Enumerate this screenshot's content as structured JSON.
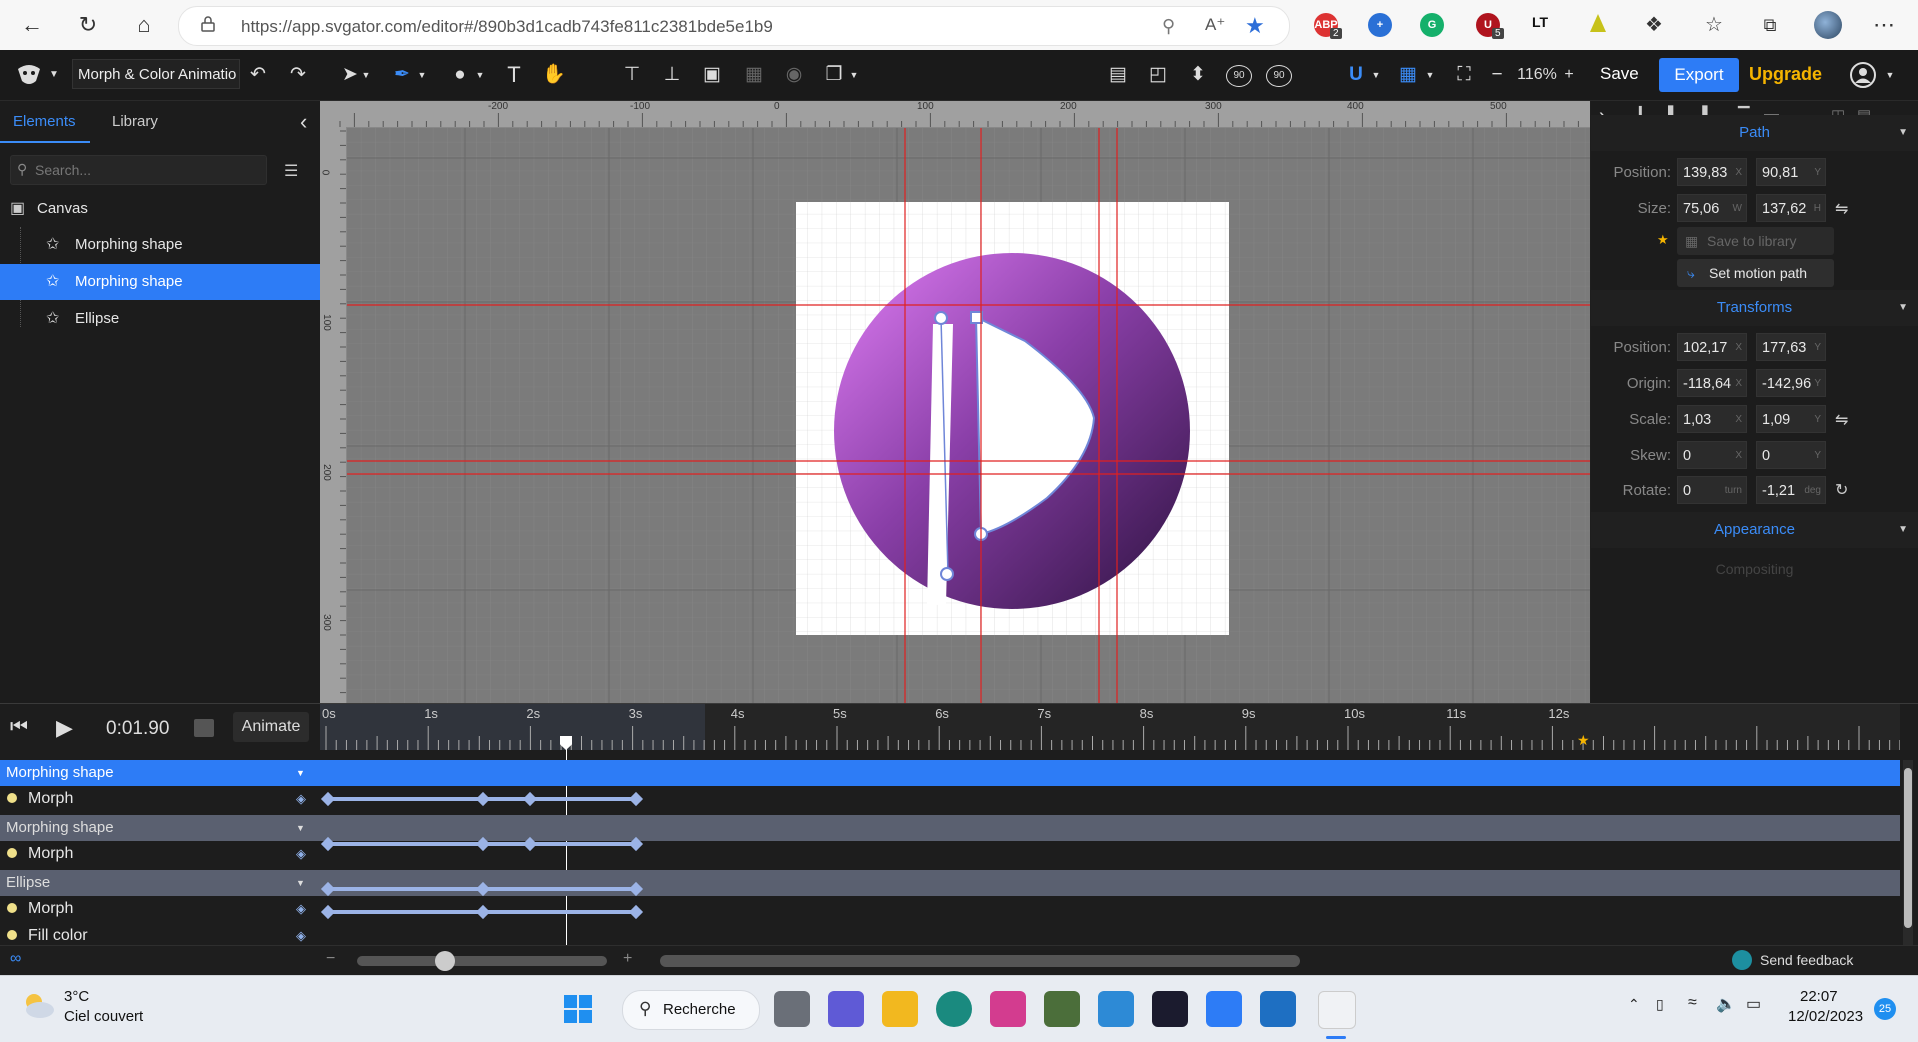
{
  "browser": {
    "url": "https://app.svgator.com/editor#/890b3d1cadb743fe811c2381bde5e1b9",
    "ext_badge_1": "2",
    "ext_badge_2": "5",
    "ext_lt": "LT"
  },
  "toolbar": {
    "doc_name": "Morph & Color Animatio",
    "zoom": "116%",
    "zoom_minus": "−",
    "zoom_plus": "+",
    "save_label": "Save",
    "export_label": "Export",
    "upgrade_label": "Upgrade",
    "rot_90a": "90",
    "rot_90b": "90"
  },
  "left_panel": {
    "tab_elements": "Elements",
    "tab_library": "Library",
    "search_placeholder": "Search...",
    "tree": [
      {
        "label": "Canvas"
      },
      {
        "label": "Morphing shape"
      },
      {
        "label": "Morphing shape"
      },
      {
        "label": "Ellipse"
      }
    ]
  },
  "ruler": {
    "top": [
      "-200",
      "-100",
      "0",
      "100",
      "200",
      "300",
      "400",
      "500"
    ],
    "left": [
      "0",
      "100",
      "200",
      "300"
    ]
  },
  "right_panel": {
    "path_title": "Path",
    "position_label": "Position:",
    "size_label": "Size:",
    "path_pos_x": "139,83",
    "path_pos_y": "90,81",
    "size_w": "75,06",
    "size_h": "137,62",
    "save_to_library": "Save to library",
    "set_motion_path": "Set motion path",
    "transforms_title": "Transforms",
    "origin_label": "Origin:",
    "scale_label": "Scale:",
    "skew_label": "Skew:",
    "rotate_label": "Rotate:",
    "t_pos_x": "102,17",
    "t_pos_y": "177,63",
    "origin_x": "-118,64",
    "origin_y": "-142,96",
    "scale_x": "1,03",
    "scale_y": "1,09",
    "skew_x": "0",
    "skew_y": "0",
    "rotate_turn": "0",
    "rotate_deg": "-1,21",
    "unit_x": "X",
    "unit_y": "Y",
    "unit_w": "W",
    "unit_h": "H",
    "unit_turn": "turn",
    "unit_deg": "deg",
    "appearance_title": "Appearance",
    "compositing_partial": "Compositing"
  },
  "timeline": {
    "time": "0:01.90",
    "animate_label": "Animate",
    "ticks": [
      "0s",
      "1s",
      "2s",
      "3s",
      "4s",
      "5s",
      "6s",
      "7s",
      "8s",
      "9s",
      "10s",
      "11s",
      "12s"
    ],
    "group1": "Morphing shape",
    "group2": "Morphing shape",
    "group3": "Ellipse",
    "morph": "Morph",
    "fill_color": "Fill color",
    "send_feedback": "Send feedback",
    "zoom_minus": "−",
    "zoom_plus": "+"
  },
  "taskbar": {
    "temperature": "3°C",
    "weather": "Ciel couvert",
    "search_label": "Recherche",
    "time": "22:07",
    "date": "12/02/2023",
    "notif_count": "25"
  },
  "colors": {
    "accent": "#2d7cf6",
    "ellipse_gradient_start": "#d66cec",
    "ellipse_gradient_end": "#3d1a55",
    "guide_line": "#e02020",
    "upgrade": "#f5b400"
  }
}
